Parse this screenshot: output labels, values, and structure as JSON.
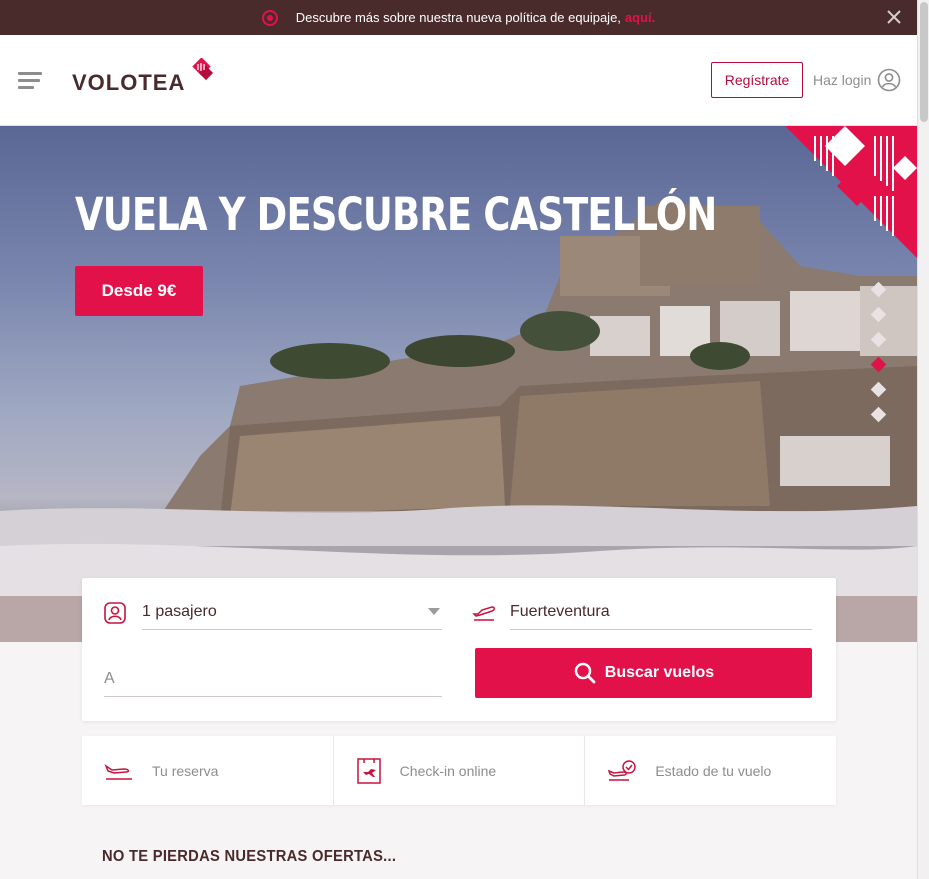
{
  "announcement": {
    "text": "Descubre más sobre nuestra nueva política de equipaje,",
    "link": "aquí."
  },
  "header": {
    "logo": "VOLOTEA",
    "register_label": "Regístrate",
    "login_label": "Haz login"
  },
  "hero": {
    "title": "VUELA Y DESCUBRE CASTELLÓN",
    "cta_label": "Desde 9€",
    "slides_total": 6,
    "active_slide": 4
  },
  "search": {
    "passengers_value": "1 pasajero",
    "origin_value": "Fuerteventura",
    "destination_placeholder": "A",
    "search_label": "Buscar vuelos"
  },
  "quick_links": [
    {
      "label": "Tu reserva",
      "icon": "plane-landing-icon"
    },
    {
      "label": "Check-in online",
      "icon": "boarding-pass-icon"
    },
    {
      "label": "Estado de tu vuelo",
      "icon": "flight-status-icon"
    }
  ],
  "offers_title": "NO TE PIERDAS NUESTRAS OFERTAS...",
  "colors": {
    "brand": "#e3114a",
    "dark": "#4a2b2c"
  }
}
